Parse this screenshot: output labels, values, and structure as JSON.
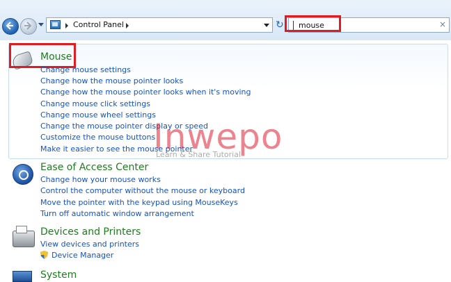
{
  "address_bar": {
    "crumbs": [
      "Control Panel"
    ],
    "search_value": "mouse",
    "clear_label": "×",
    "refresh_label": "↻"
  },
  "results": {
    "mouse": {
      "title": "Mouse",
      "links": [
        "Change mouse settings",
        "Change how the mouse pointer looks",
        "Change how the mouse pointer looks when it's moving",
        "Change mouse click settings",
        "Change mouse wheel settings",
        "Change the mouse pointer display or speed",
        "Customize the mouse buttons",
        "Make it easier to see the mouse pointer"
      ]
    },
    "ease_of_access": {
      "title": "Ease of Access Center",
      "links": [
        "Change how your mouse works",
        "Control the computer without the mouse or keyboard",
        "Move the pointer with the keypad using MouseKeys",
        "Turn off automatic window arrangement"
      ]
    },
    "devices_printers": {
      "title": "Devices and Printers",
      "links": [
        "View devices and printers",
        "Device Manager"
      ]
    },
    "system": {
      "title": "System"
    }
  },
  "watermark": {
    "brand": "Inwepo",
    "tagline": "Learn & Share Tutorial"
  },
  "colors": {
    "title_green": "#1e7d1e",
    "link_blue": "#1553c2",
    "highlight_red": "#e11b22"
  }
}
